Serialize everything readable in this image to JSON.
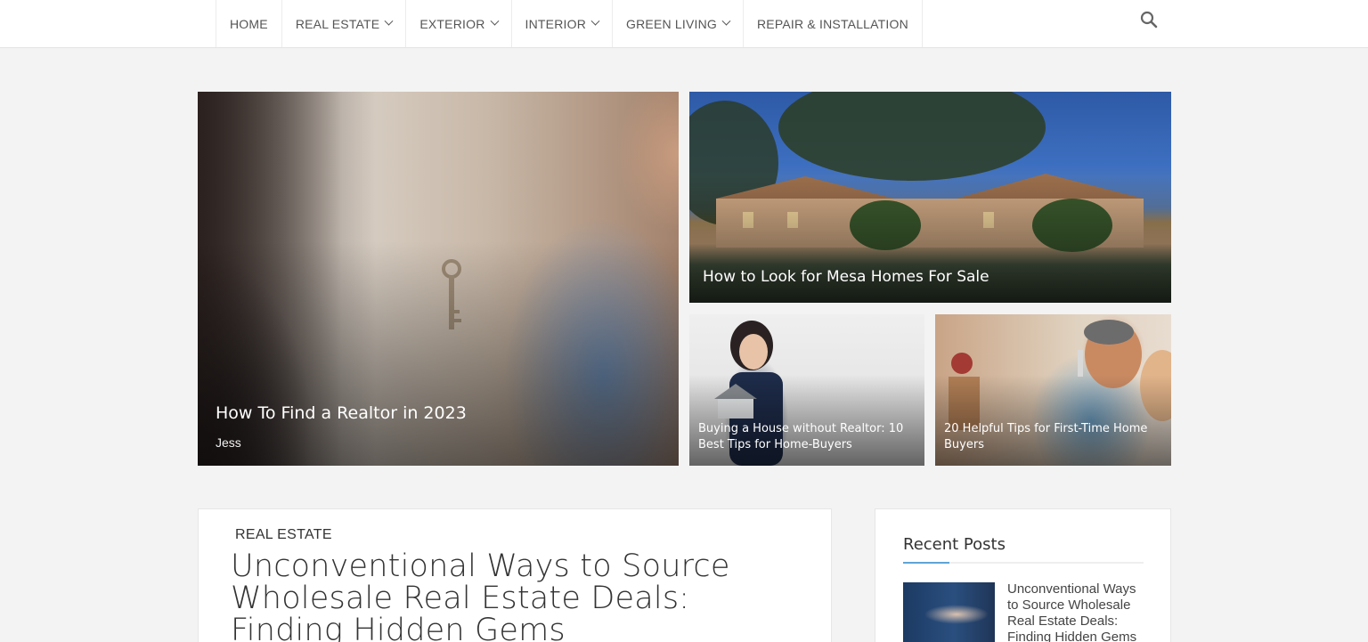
{
  "nav": {
    "items": [
      {
        "label": "HOME",
        "dropdown": false
      },
      {
        "label": "REAL ESTATE",
        "dropdown": true
      },
      {
        "label": "EXTERIOR",
        "dropdown": true
      },
      {
        "label": "INTERIOR",
        "dropdown": true
      },
      {
        "label": "GREEN LIVING",
        "dropdown": true
      },
      {
        "label": "REPAIR & INSTALLATION",
        "dropdown": false
      }
    ],
    "search_icon": "search-icon"
  },
  "featured": {
    "main": {
      "title": "How To Find a Realtor in 2023",
      "author": "Jess"
    },
    "top_right": {
      "title": "How to Look for Mesa Homes For Sale"
    },
    "small_left": {
      "title": "Buying a House without Realtor: 10 Best Tips for Home-Buyers"
    },
    "small_right": {
      "title": "20 Helpful Tips for First-Time Home Buyers"
    }
  },
  "article": {
    "category": "REAL ESTATE",
    "title": "Unconventional Ways to Source Wholesale Real Estate Deals: Finding Hidden Gems"
  },
  "sidebar": {
    "heading": "Recent Posts",
    "posts": [
      {
        "title": "Unconventional Ways to Source Wholesale Real Estate Deals: Finding Hidden Gems"
      }
    ]
  },
  "colors": {
    "accent": "#5ea4d6",
    "background": "#f3f3f3"
  }
}
